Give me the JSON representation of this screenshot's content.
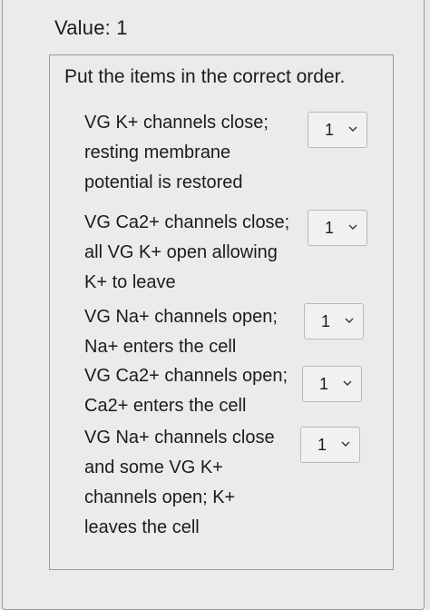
{
  "header": {
    "value_label": "Value: 1"
  },
  "question": {
    "prompt": "Put the items in the correct order.",
    "items": [
      {
        "lines": [
          "VG K+ channels close;",
          "resting membrane",
          "potential is restored"
        ],
        "selected": "1"
      },
      {
        "lines": [
          "VG Ca2+ channels close;",
          "all VG K+ open allowing",
          "K+ to leave"
        ],
        "selected": "1"
      },
      {
        "lines": [
          "VG Na+ channels open;",
          "Na+ enters the cell"
        ],
        "selected": "1"
      },
      {
        "lines": [
          "VG Ca2+ channels open;",
          "Ca2+ enters the cell"
        ],
        "selected": "1"
      },
      {
        "lines": [
          "VG Na+ channels close",
          "and some VG K+",
          "channels open; K+",
          "leaves the cell"
        ],
        "selected": "1"
      }
    ]
  },
  "icons": {
    "dropdown": "chevron-down-icon"
  },
  "colors": {
    "background": "#e7e7e5",
    "text": "#1c1c1c",
    "border": "#9a9a98"
  }
}
